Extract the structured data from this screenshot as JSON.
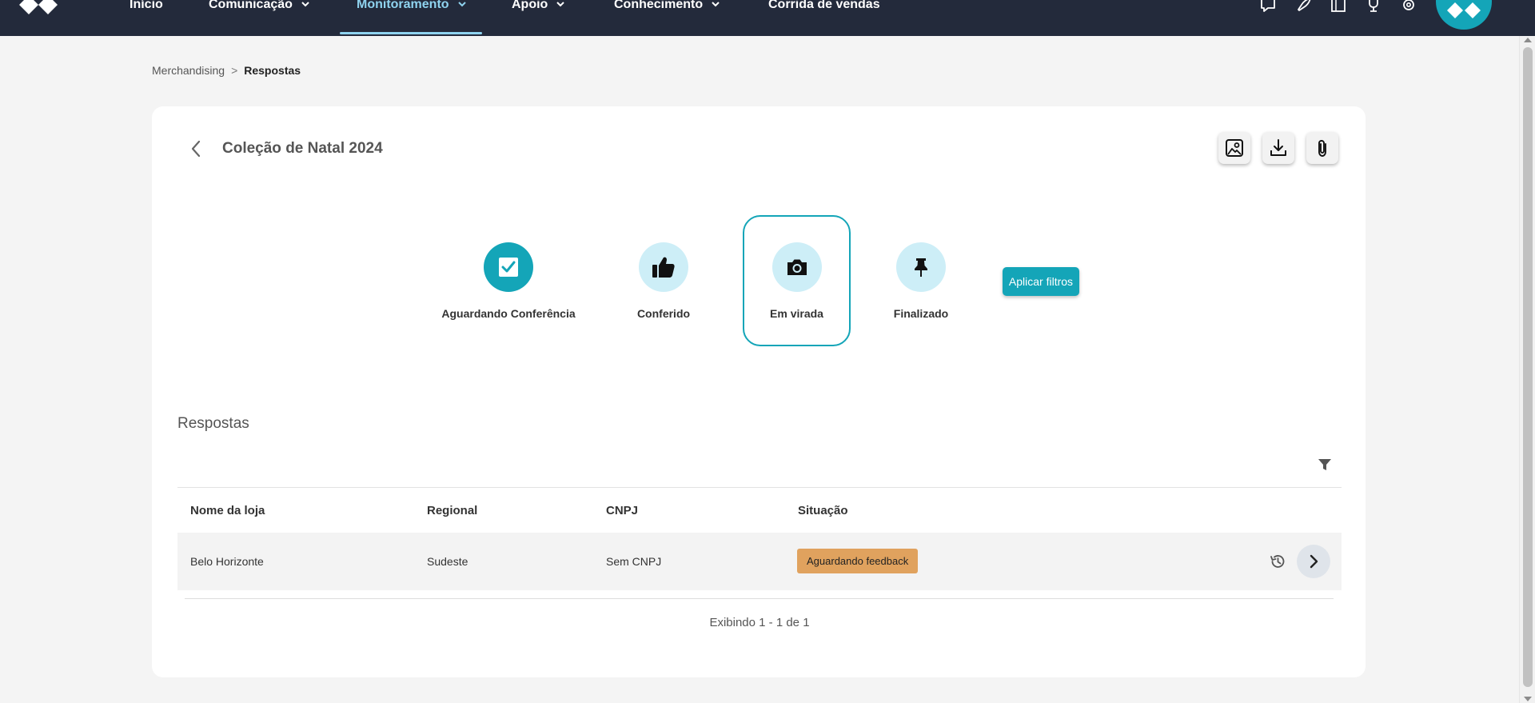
{
  "nav": {
    "items": [
      {
        "label": "Início",
        "has_dropdown": false,
        "active": false
      },
      {
        "label": "Comunicação",
        "has_dropdown": true,
        "active": false
      },
      {
        "label": "Monitoramento",
        "has_dropdown": true,
        "active": true
      },
      {
        "label": "Apoio",
        "has_dropdown": true,
        "active": false
      },
      {
        "label": "Conhecimento",
        "has_dropdown": true,
        "active": false
      },
      {
        "label": "Corrida de vendas",
        "has_dropdown": false,
        "active": false
      }
    ],
    "icons": [
      "chat-icon",
      "rocket-icon",
      "building-icon",
      "trophy-icon",
      "settings-icon"
    ],
    "colors": {
      "bar": "#232a3b",
      "active": "#8fd3ef",
      "avatar": "#14a5b8"
    }
  },
  "breadcrumb": {
    "parent": "Merchandising",
    "separator": ">",
    "current": "Respostas"
  },
  "header": {
    "title": "Coleção de Natal 2024",
    "actions": [
      "photo-gallery-icon",
      "download-icon",
      "attachment-icon"
    ]
  },
  "statuses": [
    {
      "label": "Aguardando Conferência",
      "icon": "checkbox-icon",
      "filled": true,
      "selected": false
    },
    {
      "label": "Conferido",
      "icon": "thumbs-up-icon",
      "filled": false,
      "selected": false
    },
    {
      "label": "Em virada",
      "icon": "camera-icon",
      "filled": false,
      "selected": true
    },
    {
      "label": "Finalizado",
      "icon": "pin-icon",
      "filled": false,
      "selected": false
    }
  ],
  "apply_filters_label": "Aplicar filtros",
  "section": {
    "title": "Respostas"
  },
  "table": {
    "columns": [
      "Nome da loja",
      "Regional",
      "CNPJ",
      "Situação"
    ],
    "rows": [
      {
        "store": "Belo Horizonte",
        "regional": "Sudeste",
        "cnpj": "Sem CNPJ",
        "status": "Aguardando feedback"
      }
    ],
    "pagination": "Exibindo 1 - 1 de 1"
  },
  "colors": {
    "accent": "#14a5b8",
    "status_light": "#cdeef7",
    "badge": "#e0a25e"
  }
}
